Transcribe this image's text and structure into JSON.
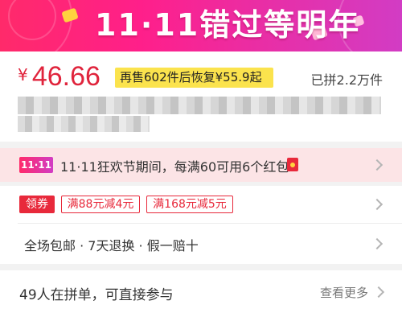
{
  "banner": {
    "title": "11·11错过等明年",
    "colors": {
      "start": "#ff2a6a",
      "end": "#d23cc4"
    }
  },
  "product": {
    "currency": "¥",
    "price": "46.66",
    "resale_notice": "再售602件后恢复¥55.9起",
    "sold_count": "已拼2.2万件"
  },
  "festival": {
    "badge": "11·11",
    "text": "11·11狂欢节期间，每满60可用6个红包"
  },
  "coupons": {
    "label": "领券",
    "items": [
      {
        "label": "满88元减4元"
      },
      {
        "label": "满168元减5元"
      }
    ]
  },
  "services": {
    "text": "全场包邮 · 7天退换 · 假一赔十"
  },
  "group_buy": {
    "text": "49人在拼单，可直接参与",
    "more_label": "查看更多"
  },
  "accent_color": "#e0243c",
  "icons": [
    "red-envelope-icon",
    "chevron-right-icon"
  ]
}
